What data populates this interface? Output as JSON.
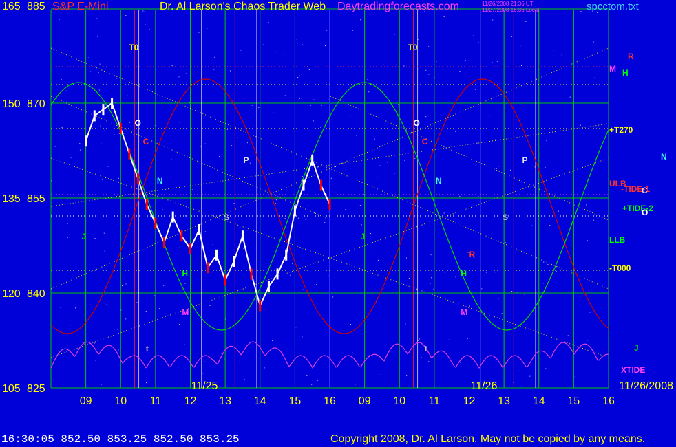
{
  "header": {
    "price_top_left": "165",
    "price_top_right": "885",
    "symbol": "S&P E-Mini",
    "title": "Dr. Al Larson's Chaos Trader Web",
    "site": "Daytradingforecasts.com",
    "stamp_line1": "11/26/2008 21:36 UT",
    "stamp_line2": "11/27/2008 16:36 Local",
    "filename": "spcctom.txt"
  },
  "footer": {
    "quote": "16:30:05  852.50  853.25  852.50  853.25",
    "copyright": "Copyright 2008, Dr. Al Larson. May not be copied by any means."
  },
  "colors": {
    "background": "#0000d8",
    "grid_green": "#00c800",
    "grid_yellow": "#e6e600",
    "price_white": "#ffffff",
    "price_red": "#ff0000",
    "tide_magenta": "#e040e0",
    "line_red": "#d00000",
    "line_green": "#00d800"
  },
  "chart_data": {
    "type": "line",
    "title": "S&P E-Mini",
    "left_axis_ticks": [
      "165",
      "150",
      "135",
      "120",
      "105"
    ],
    "right_axis_ticks": [
      "885",
      "870",
      "855",
      "840",
      "825"
    ],
    "ylim": [
      825,
      885
    ],
    "x_tick_labels": [
      "09",
      "10",
      "11",
      "12",
      "13",
      "14",
      "15",
      "16",
      "09",
      "10",
      "11",
      "12",
      "13",
      "14",
      "15",
      "16"
    ],
    "date_labels": [
      "11/25",
      "11/26",
      "11/26/2008"
    ],
    "series": [
      {
        "name": "S&P E-Mini",
        "x": [
          9.0,
          9.25,
          9.5,
          9.75,
          10.0,
          10.25,
          10.5,
          10.75,
          11.0,
          11.25,
          11.5,
          11.75,
          12.0,
          12.25,
          12.5,
          12.75,
          13.0,
          13.25,
          13.5,
          13.75,
          14.0,
          14.25,
          14.5,
          14.75,
          15.0,
          15.25,
          15.5,
          15.75,
          16.0
        ],
        "values": [
          864,
          868,
          869,
          870,
          866,
          862,
          858,
          854,
          851,
          848,
          852,
          849,
          847,
          850,
          844,
          846,
          842,
          845,
          849,
          843,
          838,
          841,
          843,
          846,
          853,
          857,
          861,
          857,
          854
        ]
      }
    ],
    "right_labels": [
      "R",
      "M",
      "H",
      "+T270",
      "N",
      "ULB",
      "-TIDE-1",
      "C",
      "+TIDE-2",
      "O",
      "LLB",
      "-T000",
      "J",
      "XTIDE"
    ],
    "day1_labels": [
      "T0",
      "O",
      "C",
      "N",
      "P",
      "S",
      "J",
      "H",
      "M",
      "t"
    ],
    "day2_labels": [
      "T0",
      "O",
      "C",
      "N",
      "P",
      "S",
      "J",
      "H",
      "M",
      "R",
      "t"
    ]
  }
}
